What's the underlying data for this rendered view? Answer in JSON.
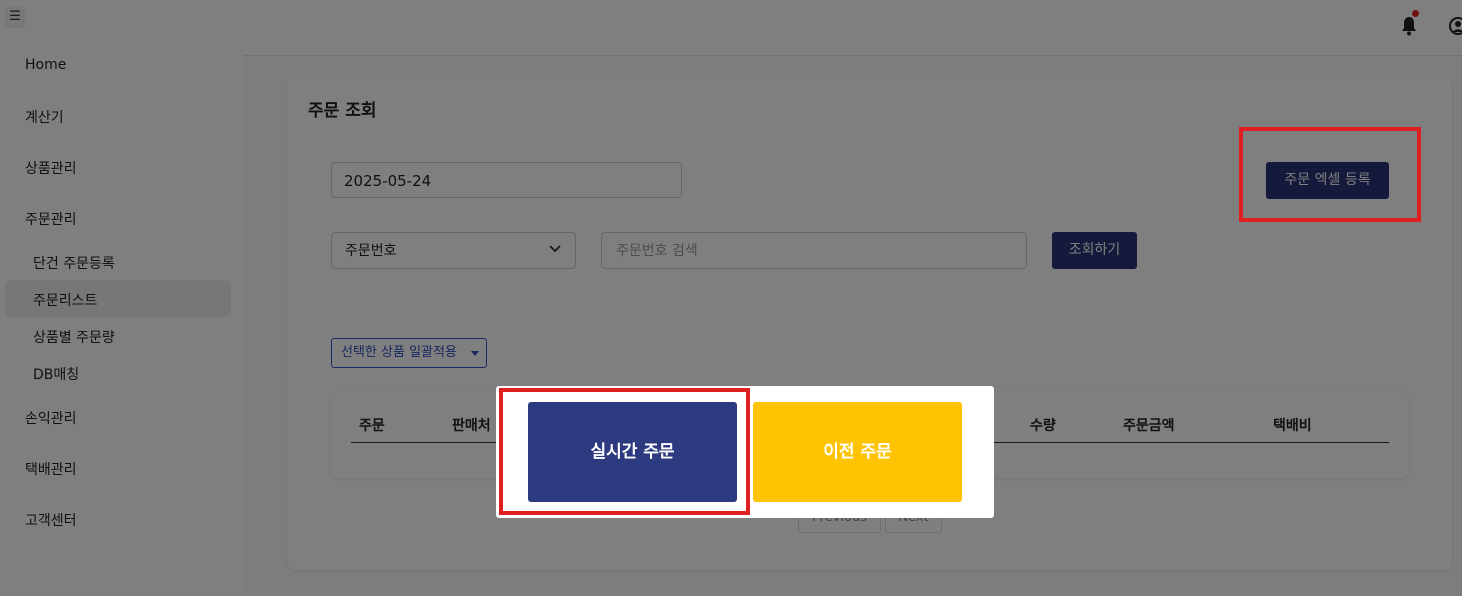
{
  "sidebar": {
    "menu_icon": "☰",
    "items": [
      {
        "label": "Home"
      },
      {
        "label": "계산기"
      },
      {
        "label": "상품관리"
      },
      {
        "label": "주문관리"
      },
      {
        "label": "손익관리"
      },
      {
        "label": "택배관리"
      },
      {
        "label": "고객센터"
      }
    ],
    "sub_items": [
      {
        "label": "단건 주문등록"
      },
      {
        "label": "주문리스트"
      },
      {
        "label": "상품별 주문량"
      },
      {
        "label": "DB매칭"
      }
    ],
    "active_sub_item": "주문리스트"
  },
  "header": {
    "icons": [
      "bell-icon",
      "user-icon"
    ],
    "notification_dot_color": "#e02020"
  },
  "main": {
    "title": "주문 조회",
    "date_value": "2025-05-24",
    "excel_button": "주문 엑셀 등록",
    "search_type_selected": "주문번호",
    "search_placeholder": "주문번호 검색",
    "search_button": "조회하기",
    "bulk_apply_button": "선택한 상품 일괄적용",
    "table_headers": [
      "주문",
      "판매처",
      "수량",
      "주문금액",
      "택배비"
    ],
    "pagination": {
      "previous": "Previous",
      "next": "Next"
    }
  },
  "modal": {
    "realtime_button": "실시간 주문",
    "previous_button": "이전 주문"
  },
  "colors": {
    "primary": "#2b357a",
    "accent_yellow": "#fec404",
    "highlight_red": "#e02020"
  }
}
